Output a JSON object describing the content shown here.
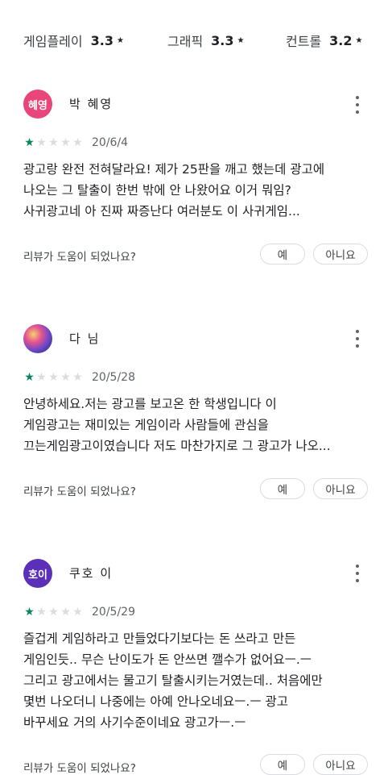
{
  "ratings": [
    {
      "label": "게임플레이",
      "value": "3.3",
      "icon": "star-icon"
    },
    {
      "label": "그래픽",
      "value": "3.3",
      "icon": "star-icon"
    },
    {
      "label": "컨트롤",
      "value": "3.2",
      "icon": "star-icon"
    }
  ],
  "colors": {
    "star_filled": "#01875f",
    "star_empty": "#dadce0",
    "avatar_1": "#e8457a",
    "avatar_3": "#5b2fb8"
  },
  "reviews": [
    {
      "avatar_text": "혜영",
      "author": "박 혜영",
      "stars": 1,
      "max_stars": 5,
      "date": "20/6/4",
      "lines": [
        "광고랑 완전 전혀달라요! 제가 25판을 깨고 했는데 광고에",
        "나오는 그 탈출이 한번 밖에 안 나왔어요 이거 뭐임?",
        "사귀광고네 아 진짜 짜증난다 여러분도 이 사귀게임..."
      ],
      "helpful": "리뷰가 도움이 되었나요?",
      "yes": "예",
      "no": "아니요"
    },
    {
      "avatar_text": "",
      "author": "다 님",
      "stars": 1,
      "max_stars": 5,
      "date": "20/5/28",
      "lines": [
        "안녕하세요.저는 광고를 보고온 한 학생입니다 이",
        "게임광고는 재미있는 게임이라 사람들에 관심을",
        "끄는게임광고이였습니다 저도 마찬가지로 그 광고가 나오..."
      ],
      "helpful": "리뷰가 도움이 되었나요?",
      "yes": "예",
      "no": "아니요"
    },
    {
      "avatar_text": "호이",
      "author": "쿠호 이",
      "stars": 1,
      "max_stars": 5,
      "date": "20/5/29",
      "lines": [
        "즐겁게 게임하라고 만들었다기보다는 돈 쓰라고 만든",
        "게임인듯.. 무슨 난이도가 돈 안쓰면 깰수가 없어요ㅡ.ㅡ",
        "그리고 광고에서는 물고기 탈출시키는거였는데.. 처음에만",
        "몇번 나오더니 나중에는 아예 안나오네요ㅡ.ㅡ 광고",
        "바꾸세요 거의 사기수준이네요 광고가ㅡ.ㅡ"
      ],
      "helpful": "리뷰가 도움이 되었나요?",
      "yes": "예",
      "no": "아니요"
    }
  ]
}
